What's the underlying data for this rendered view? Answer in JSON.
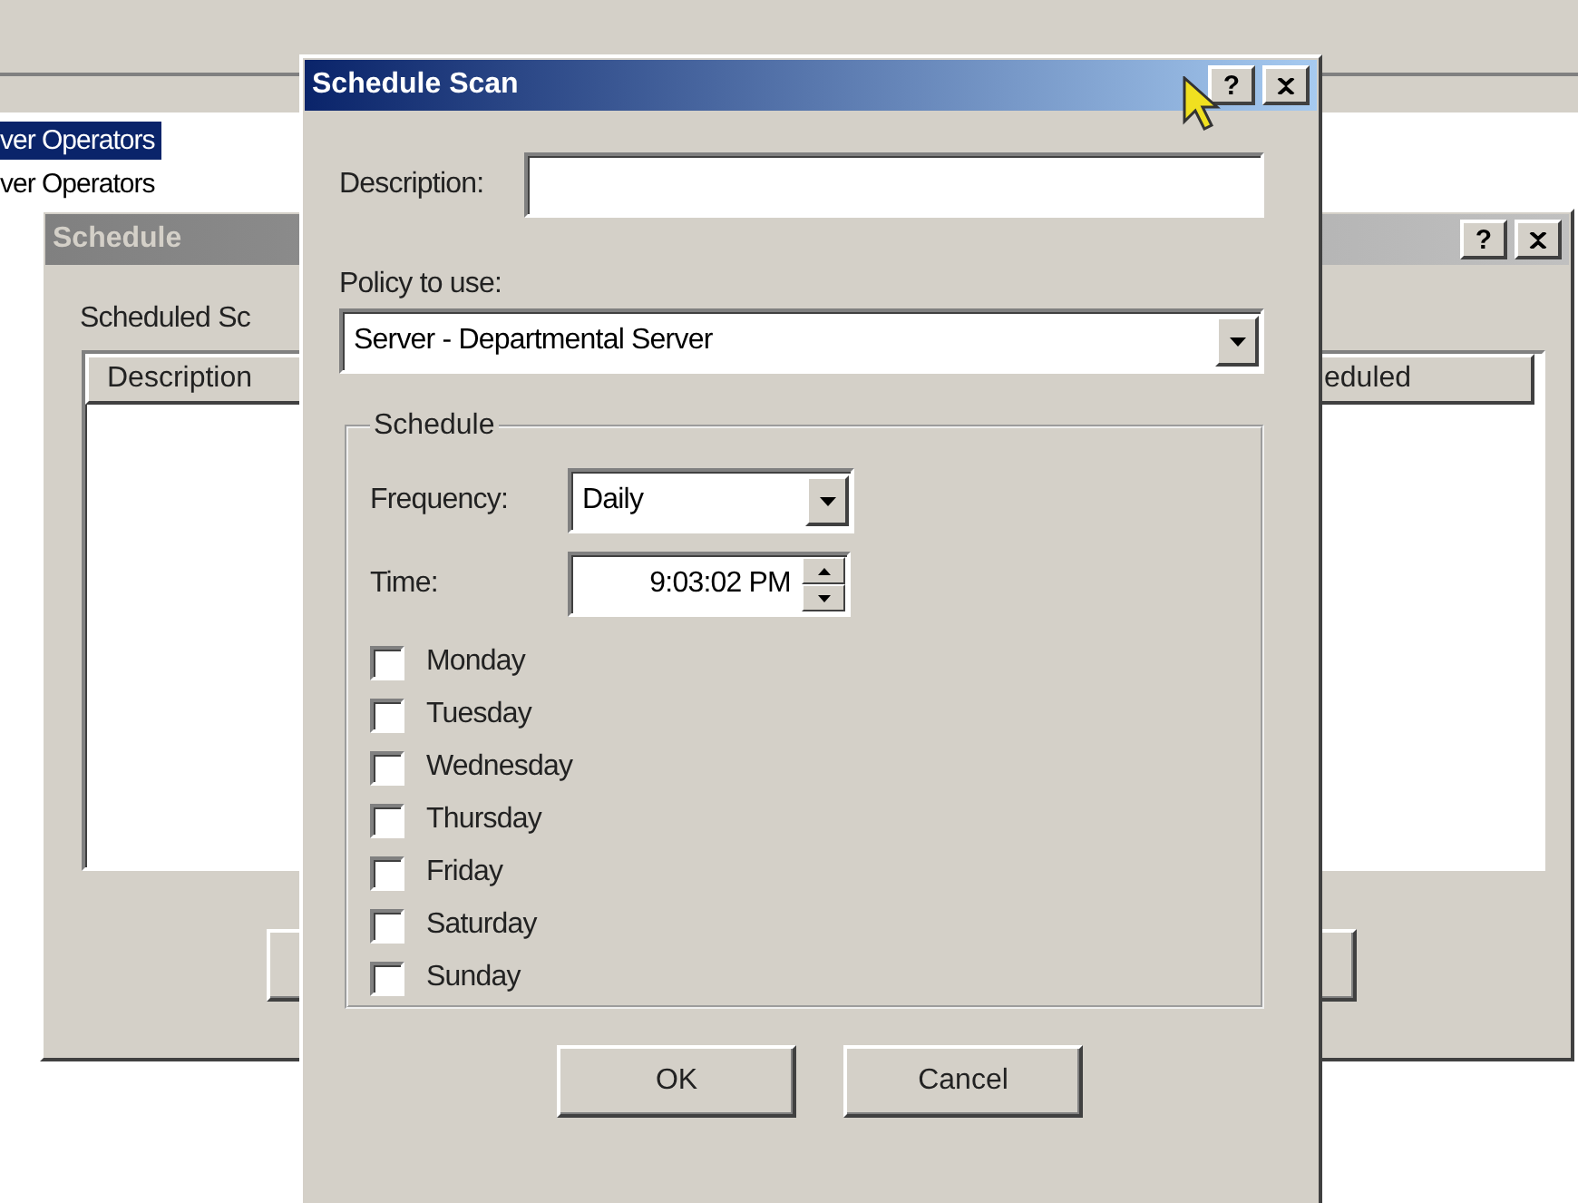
{
  "background_window": {
    "list_items": [
      {
        "label": "ver Operators",
        "selected": true
      },
      {
        "label": "ver Operators",
        "selected": false
      }
    ]
  },
  "schedule_dialog": {
    "title": "Schedule",
    "help": "?",
    "list_label": "Scheduled Sc",
    "columns": [
      "Description",
      "eduled"
    ]
  },
  "scan_dialog": {
    "title": "Schedule Scan",
    "help": "?",
    "description": {
      "label": "Description:"
    },
    "policy": {
      "label": "Policy to use:",
      "value": "Server - Departmental Server"
    },
    "schedule": {
      "legend": "Schedule",
      "frequency": {
        "label": "Frequency:",
        "value": "Daily"
      },
      "time": {
        "label": "Time:",
        "value": "9:03:02 PM"
      },
      "days": [
        {
          "label": "Monday",
          "checked": false
        },
        {
          "label": "Tuesday",
          "checked": false
        },
        {
          "label": "Wednesday",
          "checked": false
        },
        {
          "label": "Thursday",
          "checked": false
        },
        {
          "label": "Friday",
          "checked": false
        },
        {
          "label": "Saturday",
          "checked": false
        },
        {
          "label": "Sunday",
          "checked": false
        }
      ]
    },
    "buttons": [
      "OK",
      "Cancel"
    ]
  }
}
